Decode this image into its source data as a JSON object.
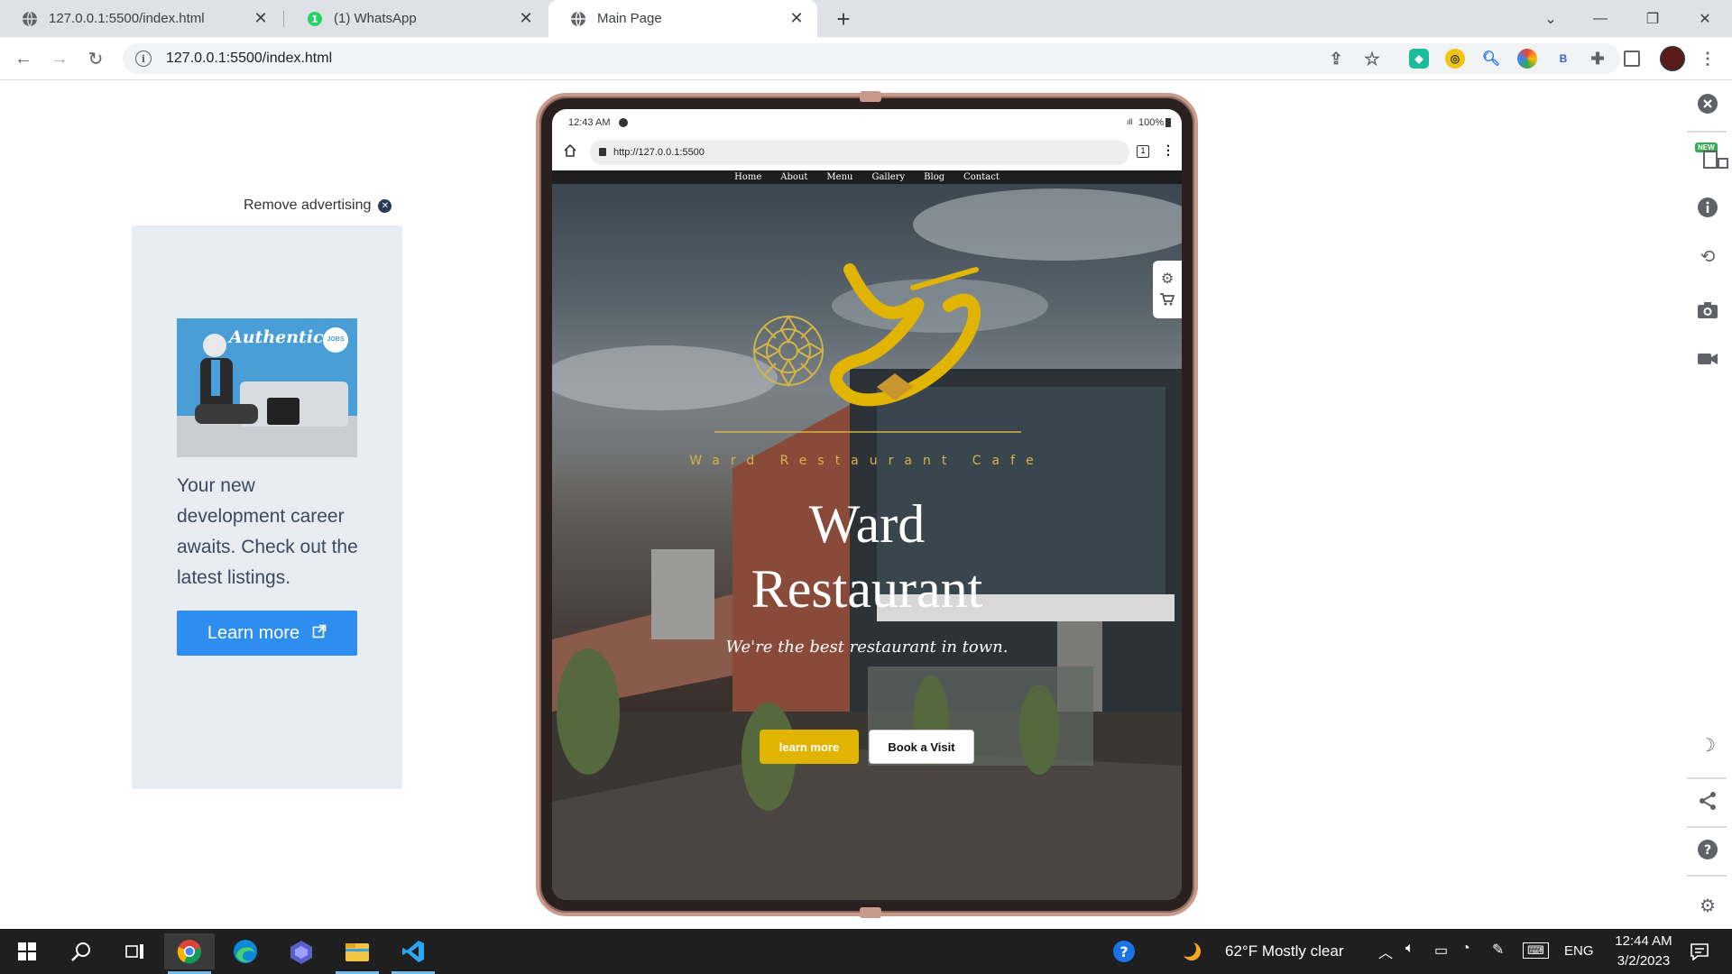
{
  "browser": {
    "tabs": [
      {
        "label": "127.0.0.1:5500/index.html",
        "icon": "globe-icon"
      },
      {
        "label": "(1) WhatsApp",
        "icon": "whatsapp-icon"
      },
      {
        "label": "Main Page",
        "icon": "globe-icon"
      }
    ],
    "url": "127.0.0.1:5500/index.html",
    "new_tab": "+",
    "extension_badge": "B"
  },
  "ad": {
    "remove_label": "Remove advertising",
    "image_brand": "Authentic",
    "image_badge": "JOBS",
    "text": "Your new development career awaits. Check out the latest listings.",
    "button_label": "Learn more"
  },
  "device": {
    "status_time": "12:43 AM",
    "status_battery": "100%",
    "address": "http://127.0.0.1:5500",
    "site": {
      "nav": [
        "Home",
        "About",
        "Menu",
        "Gallery",
        "Blog",
        "Contact"
      ],
      "logo_subtitle": "Ward Restaurant Cafe",
      "title_line1": "Ward",
      "title_line2": "Restaurant",
      "tagline": "We're the best restaurant in town.",
      "primary_button": "learn more",
      "secondary_button": "Book a Visit",
      "colors": {
        "accent": "#e0b400",
        "dark_nav": "#1e1e1e"
      }
    }
  },
  "right_sidebar": {
    "new_badge": "NEW"
  },
  "taskbar": {
    "weather": "62°F  Mostly clear",
    "language": "ENG",
    "time": "12:44 AM",
    "date": "3/2/2023"
  }
}
